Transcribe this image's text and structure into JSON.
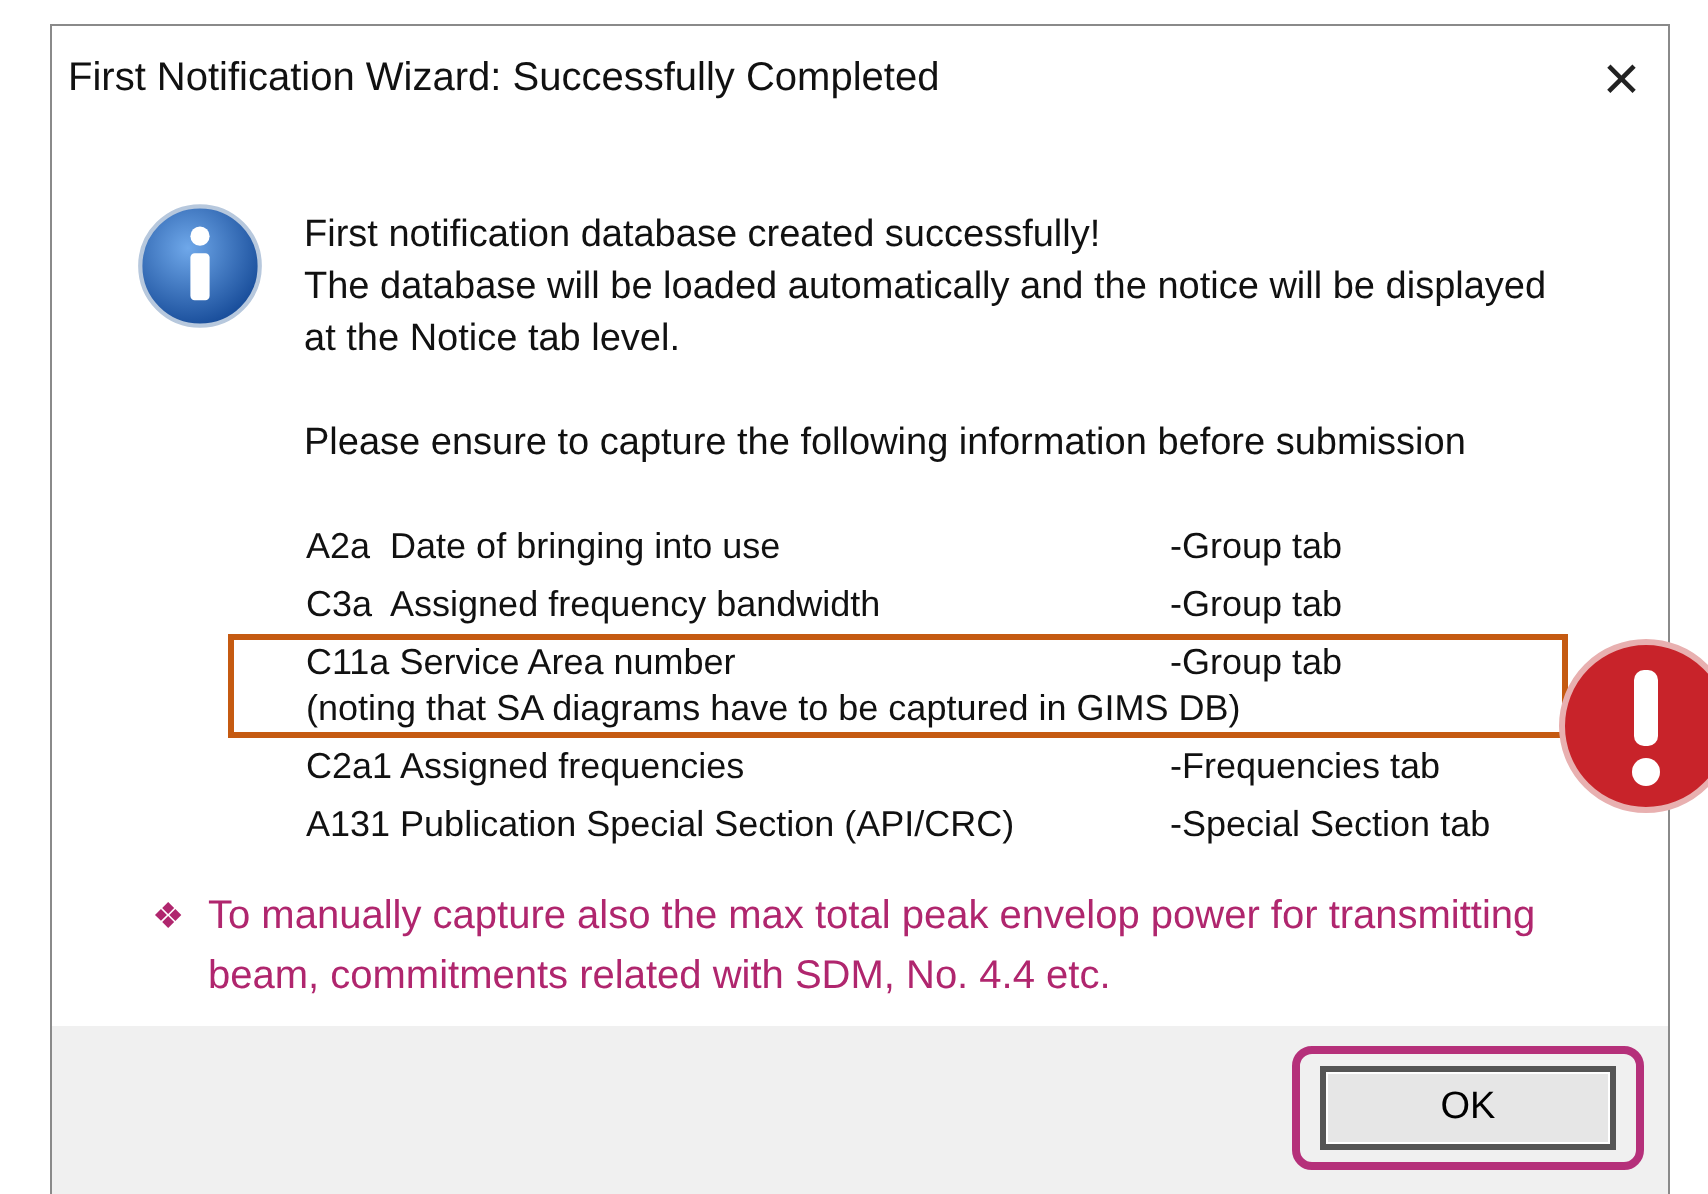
{
  "window": {
    "title": "First Notification Wizard: Successfully Completed",
    "close": "×"
  },
  "message": {
    "lines": [
      "First notification database created successfully!",
      "The database will be loaded automatically and the notice will be displayed at the Notice tab level."
    ],
    "instruction": "Please ensure to capture the following information before submission",
    "items": [
      {
        "text": "A2a  Date of bringing into use",
        "tab": "-Group tab",
        "highlighted": false
      },
      {
        "text": "C3a  Assigned frequency bandwidth",
        "tab": "-Group tab",
        "highlighted": false
      },
      {
        "text": "C11a Service Area number",
        "tab": "-Group tab",
        "note": "(noting that SA diagrams have to be captured in GIMS DB)",
        "highlighted": true
      },
      {
        "text": "C2a1 Assigned frequencies",
        "tab": "-Frequencies tab",
        "highlighted": false
      },
      {
        "text": "A131 Publication Special Section (API/CRC)",
        "tab": "-Special Section tab",
        "highlighted": false
      }
    ]
  },
  "annotation": {
    "bullet": "❖",
    "text": "To manually capture also the max total peak envelop power for transmitting beam, commitments related with SDM, No. 4.4 etc."
  },
  "buttons": [
    {
      "label": "OK",
      "highlighted": true
    }
  ]
}
